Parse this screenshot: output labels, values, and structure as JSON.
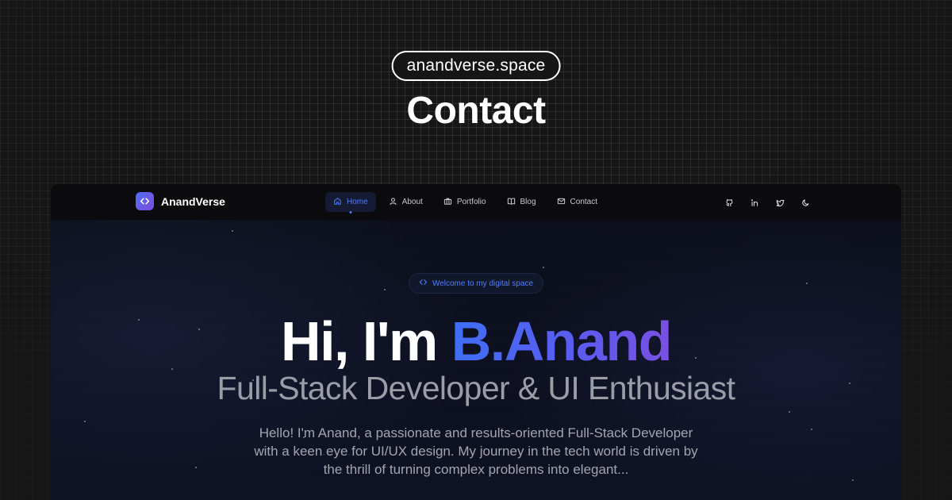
{
  "header": {
    "site_pill": "anandverse.space",
    "page_heading": "Contact"
  },
  "navbar": {
    "brand_name": "AnandVerse",
    "brand_icon": "code-brackets-icon",
    "items": [
      {
        "label": "Home",
        "icon": "home-icon",
        "active": true
      },
      {
        "label": "About",
        "icon": "user-icon",
        "active": false
      },
      {
        "label": "Portfolio",
        "icon": "briefcase-icon",
        "active": false
      },
      {
        "label": "Blog",
        "icon": "book-open-icon",
        "active": false
      },
      {
        "label": "Contact",
        "icon": "mail-icon",
        "active": false
      }
    ],
    "right_icons": [
      "github-icon",
      "linkedin-icon",
      "twitter-icon",
      "moon-icon"
    ]
  },
  "hero": {
    "badge": "Welcome to my digital space",
    "title_prefix": "Hi, I'm ",
    "title_name": "B.Anand",
    "subtitle": "Full-Stack Developer & UI Enthusiast",
    "description": "Hello! I'm Anand, a passionate and results-oriented Full-Stack Developer with a keen eye for UI/UX design. My journey in the tech world is driven by the thrill of turning complex problems into elegant..."
  },
  "colors": {
    "accent": "#4d7cff",
    "gradient_start": "#3f6ef5",
    "gradient_end": "#7b4fe3",
    "background": "#161616"
  }
}
